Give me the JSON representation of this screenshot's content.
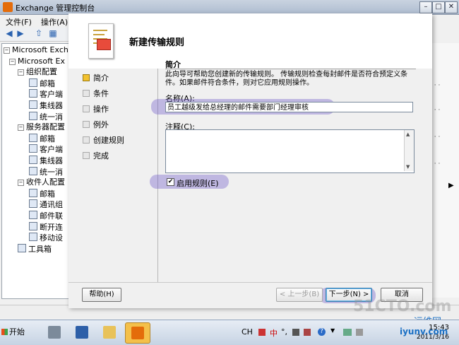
{
  "window": {
    "title": "Exchange 管理控制台",
    "min": "–",
    "max": "□",
    "close": "✕"
  },
  "menubar": {
    "file": "文件(F)",
    "action": "操作(A)"
  },
  "toolbar": {
    "back": "◀",
    "forward": "▶",
    "up": "⇧",
    "view": "▦"
  },
  "tree": [
    {
      "label": "Microsoft Exchange",
      "level": 0
    },
    {
      "label": "Microsoft Ex",
      "level": 1
    },
    {
      "label": "组织配置",
      "level": 2
    },
    {
      "label": "邮箱",
      "level": 3
    },
    {
      "label": "客户端",
      "level": 3
    },
    {
      "label": "集线器",
      "level": 3
    },
    {
      "label": "统一消",
      "level": 3
    },
    {
      "label": "服务器配置",
      "level": 2
    },
    {
      "label": "邮箱",
      "level": 3
    },
    {
      "label": "客户端",
      "level": 3
    },
    {
      "label": "集线器",
      "level": 3
    },
    {
      "label": "统一消",
      "level": 3
    },
    {
      "label": "收件人配置",
      "level": 2
    },
    {
      "label": "邮箱",
      "level": 3
    },
    {
      "label": "通讯组",
      "level": 3
    },
    {
      "label": "邮件联",
      "level": 3
    },
    {
      "label": "断开连",
      "level": 3
    },
    {
      "label": "移动设",
      "level": 3
    },
    {
      "label": "工具箱",
      "level": 2
    }
  ],
  "wizard": {
    "title": "新建传输规则",
    "steps": [
      {
        "label": "简介",
        "active": true
      },
      {
        "label": "条件",
        "active": false
      },
      {
        "label": "操作",
        "active": false
      },
      {
        "label": "例外",
        "active": false
      },
      {
        "label": "创建规则",
        "active": false
      },
      {
        "label": "完成",
        "active": false
      }
    ],
    "section_title": "简介",
    "description": "此向导可帮助您创建新的传输规则。 传输规则检查每封邮件是否符合预定义条件。如果邮件符合条件，则对它应用规则操作。",
    "name_label": "名称(A):",
    "name_value": "员工越级发给总经理的邮件需要部门经理审核",
    "comment_label": "注释(C):",
    "comment_value": "",
    "enable_label": "启用规则(E)",
    "enable_checked": "✔",
    "buttons": {
      "help": "帮助(H)",
      "back": "< 上一步(B)",
      "next": "下一步(N) >",
      "cancel": "取消"
    }
  },
  "taskbar": {
    "start": "开始",
    "lang": "CH",
    "ime": "中",
    "time": "15:43",
    "date": "2011/3/16"
  },
  "watermarks": {
    "site1": "51CTO.com",
    "site2": "运维网",
    "site3": "iyunv.com"
  },
  "colors": {
    "highlight": "#6e5ac8",
    "active_task": "#f4c04a",
    "step_active": "#f2c12e"
  }
}
